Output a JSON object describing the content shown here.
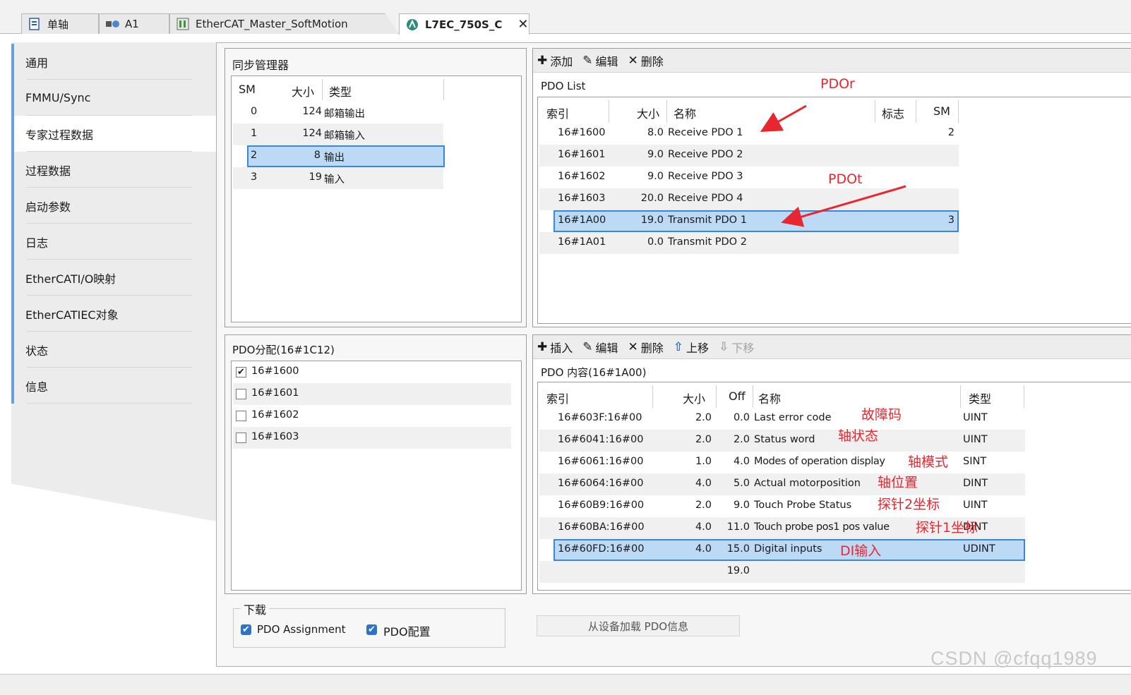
{
  "tabs": [
    {
      "label": "单轴",
      "icon": "page-icon"
    },
    {
      "label": "A1",
      "icon": "axis-icon"
    },
    {
      "label": "EtherCAT_Master_SoftMotion",
      "icon": "master-icon"
    },
    {
      "label": "L7EC_750S_C",
      "icon": "device-icon",
      "active": true
    }
  ],
  "close_glyph": "✕",
  "nav": [
    "通用",
    "FMMU/Sync",
    "专家过程数据",
    "过程数据",
    "启动参数",
    "日志",
    "EtherCATI/O映射",
    "EtherCATIEC对象",
    "状态",
    "信息"
  ],
  "nav_active": 2,
  "sync_manager": {
    "title": "同步管理器",
    "headers": {
      "sm": "SM",
      "size": "大小",
      "type": "类型"
    },
    "rows": [
      {
        "sm": "0",
        "size": "124",
        "type": "邮箱输出"
      },
      {
        "sm": "1",
        "size": "124",
        "type": "邮箱输入"
      },
      {
        "sm": "2",
        "size": "8",
        "type": "输出",
        "selected": true
      },
      {
        "sm": "3",
        "size": "19",
        "type": "输入"
      }
    ]
  },
  "pdo_toolbar": {
    "add": "添加",
    "edit": "编辑",
    "delete": "删除"
  },
  "pdo_list": {
    "title": "PDO List",
    "headers": {
      "index": "索引",
      "size": "大小",
      "name": "名称",
      "flags": "标志",
      "sm": "SM"
    },
    "rows": [
      {
        "index": "16#1600",
        "size": "8.0",
        "name": "Receive PDO 1",
        "flags": "",
        "sm": "2"
      },
      {
        "index": "16#1601",
        "size": "9.0",
        "name": "Receive PDO 2",
        "flags": "",
        "sm": ""
      },
      {
        "index": "16#1602",
        "size": "9.0",
        "name": "Receive PDO 3",
        "flags": "",
        "sm": ""
      },
      {
        "index": "16#1603",
        "size": "20.0",
        "name": "Receive PDO 4",
        "flags": "",
        "sm": ""
      },
      {
        "index": "16#1A00",
        "size": "19.0",
        "name": "Transmit PDO 1",
        "flags": "",
        "sm": "3",
        "selected": true
      },
      {
        "index": "16#1A01",
        "size": "0.0",
        "name": "Transmit PDO 2",
        "flags": "",
        "sm": ""
      }
    ]
  },
  "pdo_assign": {
    "title": "PDO分配(16#1C12)",
    "items": [
      {
        "label": "16#1600",
        "checked": true
      },
      {
        "label": "16#1601",
        "checked": false
      },
      {
        "label": "16#1602",
        "checked": false
      },
      {
        "label": "16#1603",
        "checked": false
      }
    ]
  },
  "content_toolbar": {
    "insert": "插入",
    "edit": "编辑",
    "delete": "删除",
    "move_up": "上移",
    "move_down": "下移"
  },
  "pdo_content": {
    "title": "PDO 内容(16#1A00)",
    "headers": {
      "index": "索引",
      "size": "大小",
      "off": "Off",
      "name": "名称",
      "type": "类型"
    },
    "rows": [
      {
        "index": "16#603F:16#00",
        "size": "2.0",
        "off": "0.0",
        "name": "Last error code",
        "type": "UINT"
      },
      {
        "index": "16#6041:16#00",
        "size": "2.0",
        "off": "2.0",
        "name": "Status word",
        "type": "UINT"
      },
      {
        "index": "16#6061:16#00",
        "size": "1.0",
        "off": "4.0",
        "name": "Modes of operation display",
        "type": "SINT"
      },
      {
        "index": "16#6064:16#00",
        "size": "4.0",
        "off": "5.0",
        "name": "Actual motorposition",
        "type": "DINT"
      },
      {
        "index": "16#60B9:16#00",
        "size": "2.0",
        "off": "9.0",
        "name": "Touch Probe Status",
        "type": "UINT"
      },
      {
        "index": "16#60BA:16#00",
        "size": "4.0",
        "off": "11.0",
        "name": "Touch probe pos1 pos value",
        "type": "DINT"
      },
      {
        "index": "16#60FD:16#00",
        "size": "4.0",
        "off": "15.0",
        "name": "Digital inputs",
        "type": "UDINT",
        "selected": true
      },
      {
        "index": "",
        "size": "",
        "off": "19.0",
        "name": "",
        "type": ""
      }
    ]
  },
  "download": {
    "title": "下载",
    "pdo_assignment": "PDO Assignment",
    "pdo_config": "PDO配置"
  },
  "load_button": "从设备加载 PDO信息",
  "annotations": {
    "pdor": "PDOr",
    "pdot": "PDOt",
    "error_code": "故障码",
    "axis_status": "轴状态",
    "axis_mode": "轴模式",
    "axis_position": "轴位置",
    "probe2": "探针2坐标",
    "probe1": "探针1坐标",
    "di_input": "DI输入",
    "color": "#e8262f"
  },
  "watermark": "CSDN @cfqq1989"
}
